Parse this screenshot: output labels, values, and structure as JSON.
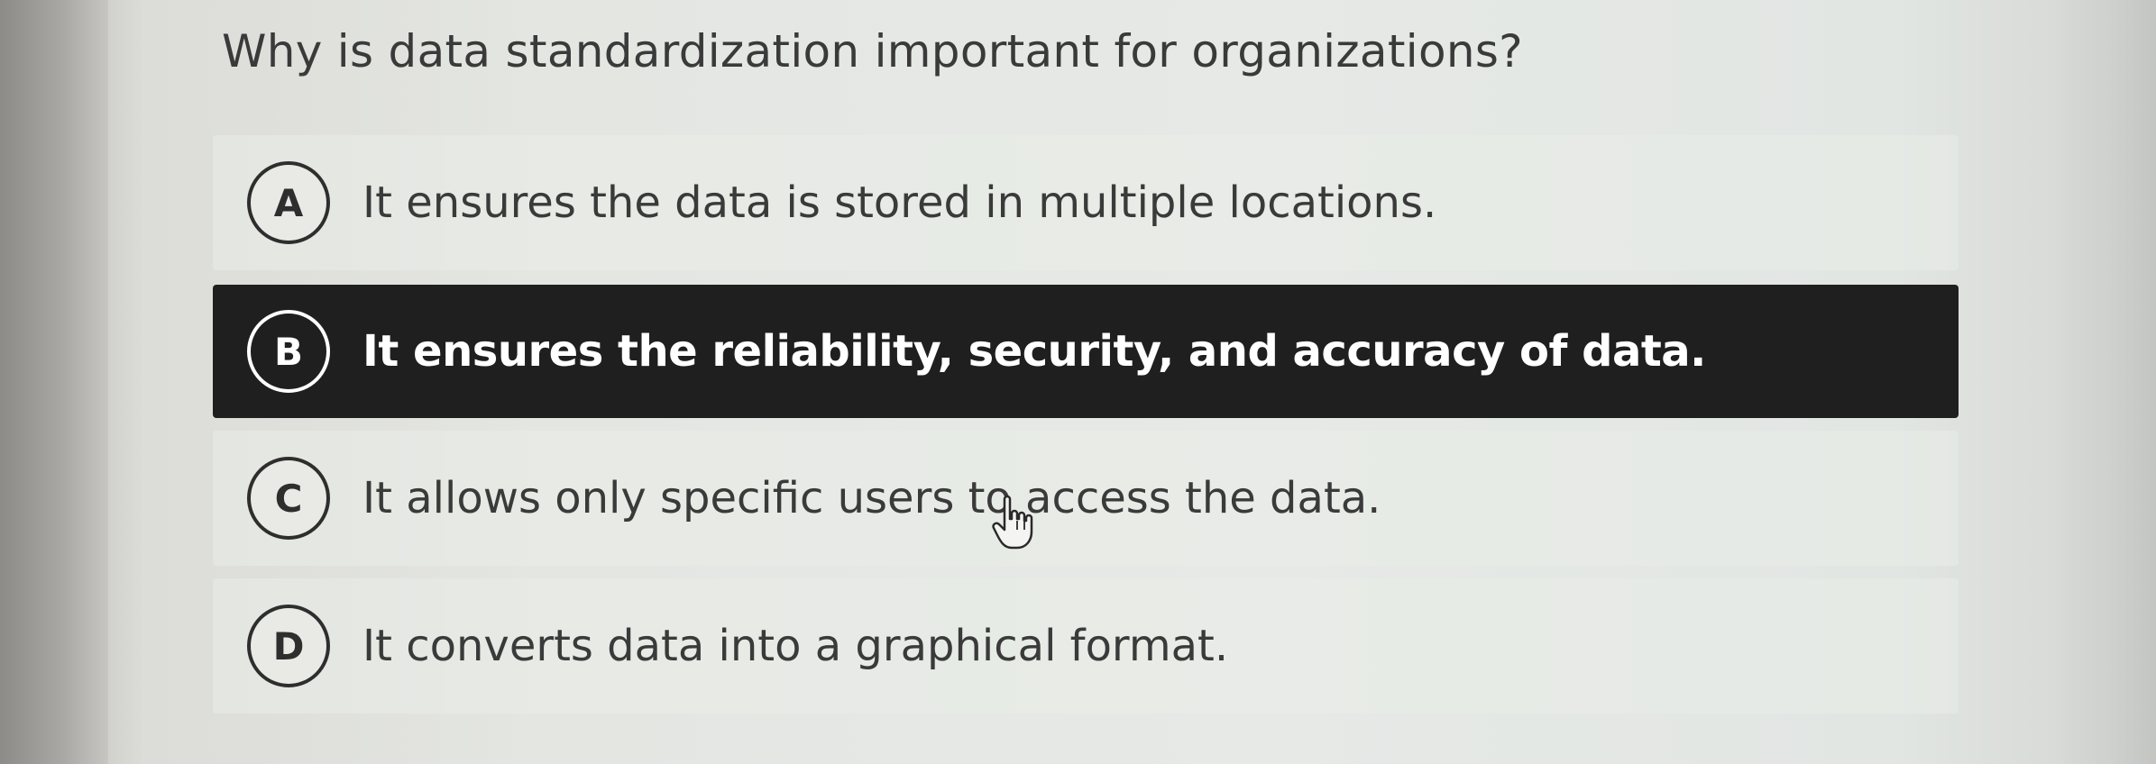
{
  "question": {
    "text": "Why is data standardization important for organizations?"
  },
  "options": [
    {
      "letter": "A",
      "text": "It ensures the data is stored in multiple locations.",
      "selected": false
    },
    {
      "letter": "B",
      "text": "It ensures the reliability, security, and accuracy of data.",
      "selected": true
    },
    {
      "letter": "C",
      "text": "It allows only specific users to access the data.",
      "selected": false
    },
    {
      "letter": "D",
      "text": "It converts data into a graphical format.",
      "selected": false
    }
  ],
  "colors": {
    "selected_background": "#1f1f1f",
    "selected_text": "#ffffff",
    "text": "#3a3a3a"
  },
  "icons": {
    "cursor": "hand-pointer-icon"
  }
}
